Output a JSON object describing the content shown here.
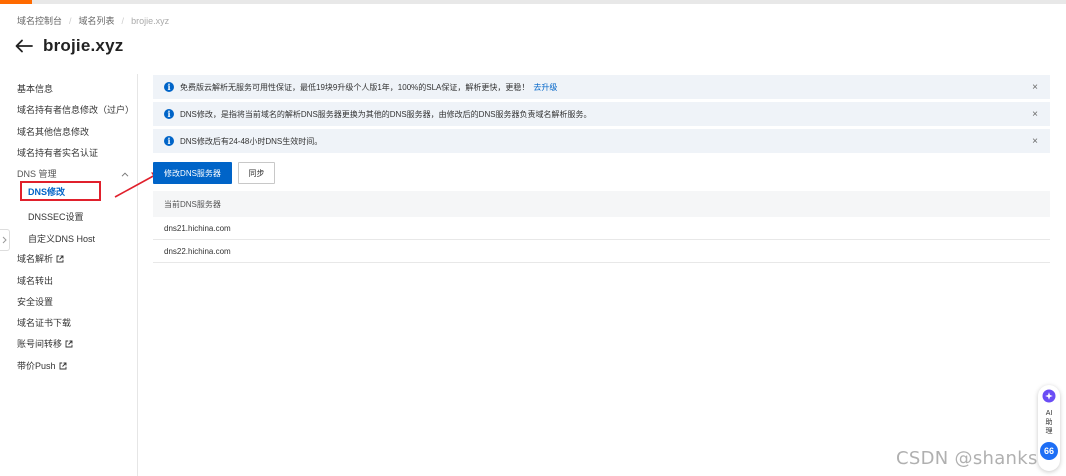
{
  "breadcrumb": {
    "items": [
      "域名控制台",
      "域名列表",
      "brojie.xyz"
    ],
    "separator": "/"
  },
  "page": {
    "title": "brojie.xyz"
  },
  "sidebar": {
    "items": [
      {
        "label": "基本信息"
      },
      {
        "label": "域名持有者信息修改（过户）"
      },
      {
        "label": "域名其他信息修改"
      },
      {
        "label": "域名持有者实名认证"
      },
      {
        "label": "DNS 管理"
      },
      {
        "label": "DNS修改"
      },
      {
        "label": "DNSSEC设置"
      },
      {
        "label": "自定义DNS Host"
      },
      {
        "label": "域名解析"
      },
      {
        "label": "域名转出"
      },
      {
        "label": "安全设置"
      },
      {
        "label": "域名证书下载"
      },
      {
        "label": "账号间转移"
      },
      {
        "label": "带价Push"
      }
    ]
  },
  "alerts": [
    {
      "text": "免费版云解析无服务可用性保证，最低19块9升级个人版1年，100%的SLA保证，解析更快，更稳！",
      "link": "去升级",
      "close": "×"
    },
    {
      "text": "DNS修改，是指将当前域名的解析DNS服务器更换为其他的DNS服务器，由修改后的DNS服务器负责域名解析服务。",
      "close": "×"
    },
    {
      "text": "DNS修改后有24-48小时DNS生效时间。",
      "close": "×"
    }
  ],
  "actions": {
    "modify_label": "修改DNS服务器",
    "sync_label": "同步"
  },
  "dns_table": {
    "header": "当前DNS服务器",
    "rows": [
      "dns21.hichina.com",
      "dns22.hichina.com"
    ]
  },
  "ai_assistant": {
    "label": "AI助理",
    "badge": "66"
  },
  "watermark": "CSDN @shanks",
  "colors": {
    "primary": "#0064c8",
    "annotation_red": "#e0202c",
    "alert_bg": "#eff3f8",
    "brand_orange": "#ff6a00"
  },
  "icons": [
    "back-arrow-icon",
    "chevron-up-icon",
    "external-link-icon",
    "info-icon",
    "close-icon",
    "chevron-right-icon",
    "ai-logo-icon"
  ]
}
